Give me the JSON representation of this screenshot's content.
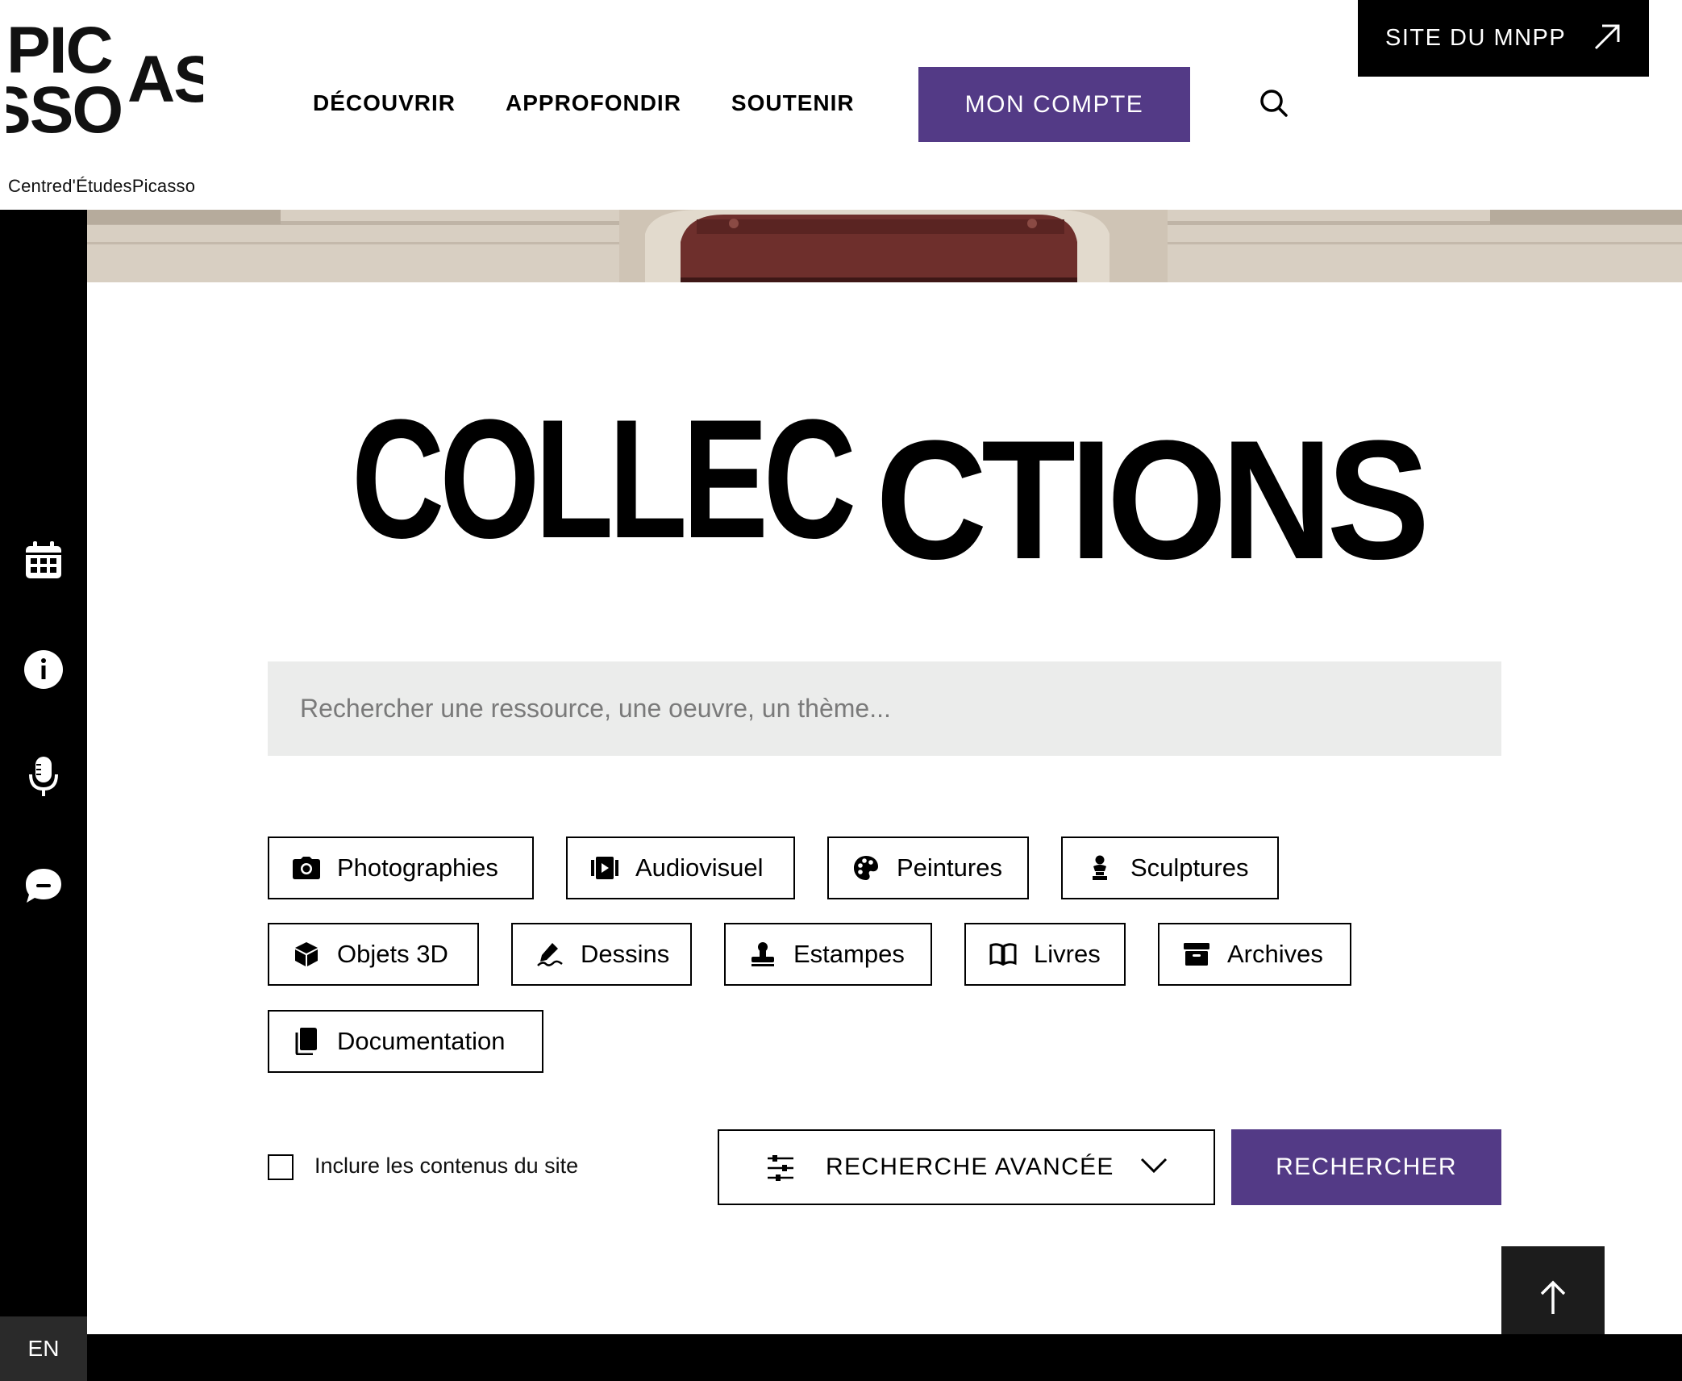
{
  "brand": {
    "logo_letters": [
      "PIC",
      "AS",
      "SSO"
    ],
    "subtitle": "Centred'ÉtudesPicasso"
  },
  "nav": {
    "items": [
      {
        "label": "DÉCOUVRIR"
      },
      {
        "label": "APPROFONDIR"
      },
      {
        "label": "SOUTENIR"
      }
    ],
    "account_label": "MON COMPTE",
    "external_label": "SITE DU MNPP"
  },
  "sidebar": {
    "icons": [
      "calendar-icon",
      "info-icon",
      "microphone-icon",
      "chat-icon"
    ],
    "lang_label": "EN"
  },
  "page": {
    "title_part1": "COLLEC",
    "title_part2": "CTIONS"
  },
  "search": {
    "placeholder": "Rechercher une ressource, une oeuvre, un thème...",
    "value": ""
  },
  "categories": [
    {
      "label": "Photographies",
      "icon": "camera-icon"
    },
    {
      "label": "Audiovisuel",
      "icon": "video-icon"
    },
    {
      "label": "Peintures",
      "icon": "palette-icon"
    },
    {
      "label": "Sculptures",
      "icon": "sculpture-icon"
    },
    {
      "label": "Objets 3D",
      "icon": "cube-icon"
    },
    {
      "label": "Dessins",
      "icon": "pen-icon"
    },
    {
      "label": "Estampes",
      "icon": "stamp-icon"
    },
    {
      "label": "Livres",
      "icon": "book-icon"
    },
    {
      "label": "Archives",
      "icon": "archive-icon"
    },
    {
      "label": "Documentation",
      "icon": "documents-icon"
    }
  ],
  "controls": {
    "include_site_label": "Inclure les contenus du site",
    "include_site_checked": false,
    "advanced_label": "RECHERCHE AVANCÉE",
    "submit_label": "RECHERCHER"
  },
  "colors": {
    "accent": "#533a86",
    "black": "#000000",
    "search_bg": "#ebeceb"
  }
}
